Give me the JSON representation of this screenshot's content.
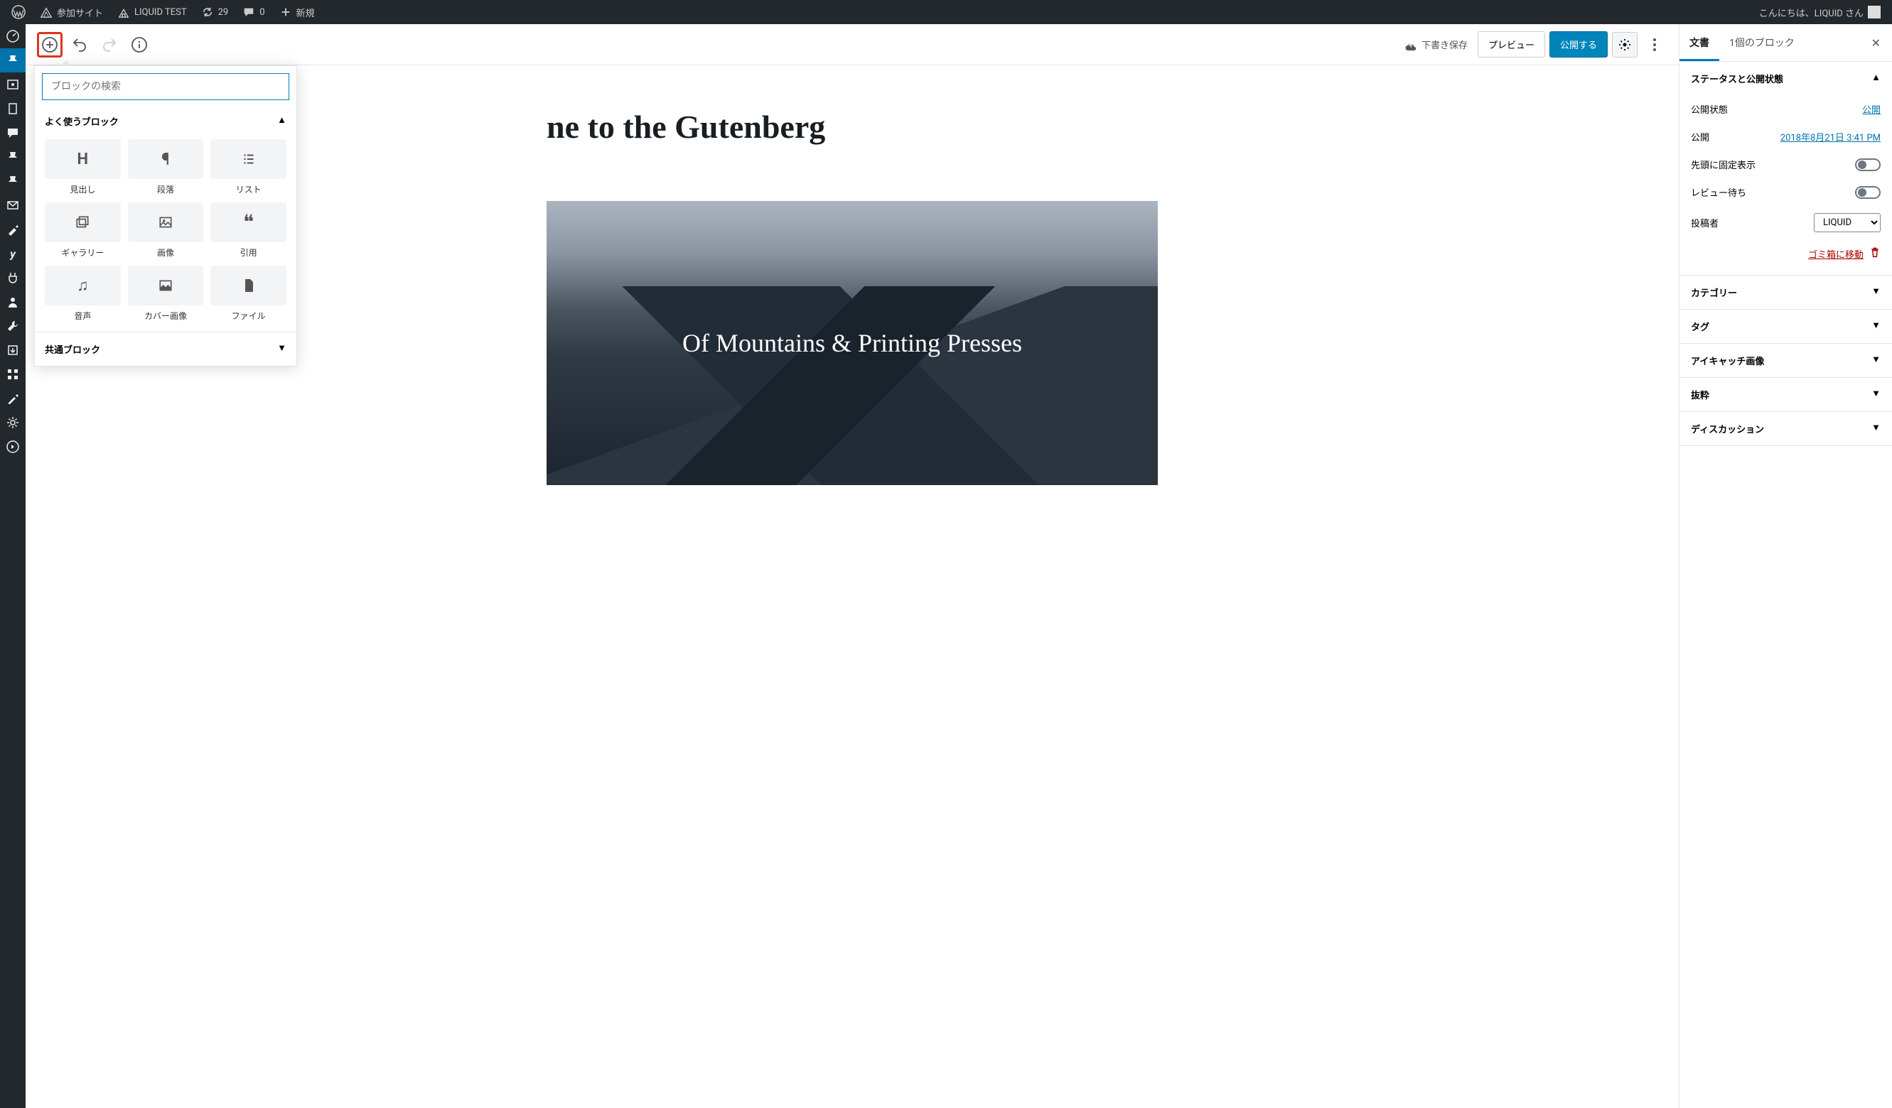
{
  "adminbar": {
    "sites_label": "参加サイト",
    "site_name": "LIQUID TEST",
    "updates_count": "29",
    "comments_count": "0",
    "new_label": "新規",
    "greeting": "こんにちは、LIQUID さん"
  },
  "toolbar": {
    "save_draft": "下書き保存",
    "preview": "プレビュー",
    "publish": "公開する"
  },
  "inserter": {
    "search_placeholder": "ブロックの検索",
    "section_frequent": "よく使うブロック",
    "section_common": "共通ブロック",
    "blocks": [
      {
        "label": "見出し",
        "icon": "H"
      },
      {
        "label": "段落",
        "icon": "¶"
      },
      {
        "label": "リスト",
        "icon": "≣"
      },
      {
        "label": "ギャラリー",
        "icon": "gallery"
      },
      {
        "label": "画像",
        "icon": "image"
      },
      {
        "label": "引用",
        "icon": "❝"
      },
      {
        "label": "音声",
        "icon": "♫"
      },
      {
        "label": "カバー画像",
        "icon": "cover"
      },
      {
        "label": "ファイル",
        "icon": "file"
      }
    ]
  },
  "content": {
    "title_visible": "ne to the Gutenberg",
    "subtitle_visible": "",
    "cover_text": "Of Mountains & Printing Presses"
  },
  "sidebar": {
    "tab_document": "文書",
    "tab_block": "1個のブロック",
    "section_status": "ステータスと公開状態",
    "visibility_label": "公開状態",
    "visibility_value": "公開",
    "publish_label": "公開",
    "publish_date": "2018年8月21日 3:41 PM",
    "sticky_label": "先頭に固定表示",
    "pending_label": "レビュー待ち",
    "author_label": "投稿者",
    "author_value": "LIQUID",
    "trash_label": "ゴミ箱に移動",
    "panels": [
      "カテゴリー",
      "タグ",
      "アイキャッチ画像",
      "抜粋",
      "ディスカッション"
    ]
  }
}
